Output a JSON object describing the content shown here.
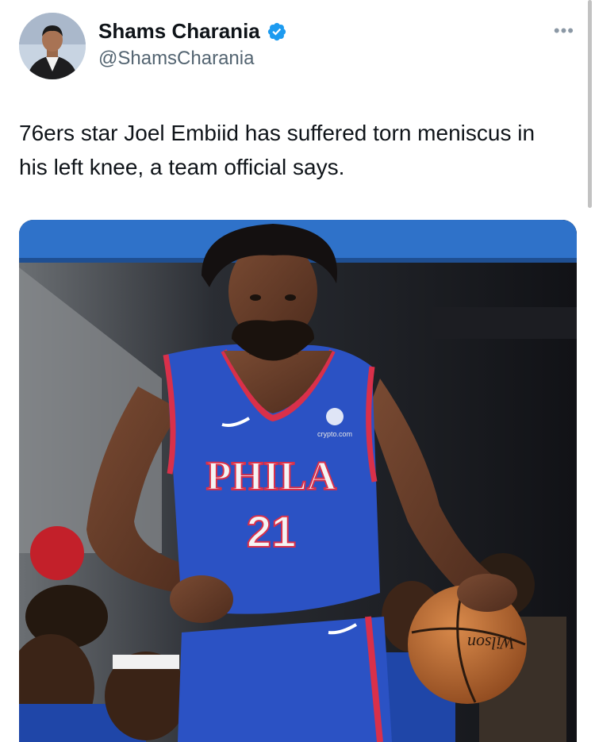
{
  "author": {
    "display_name": "Shams Charania",
    "handle": "@ShamsCharania",
    "verified": true,
    "verified_icon": "verified-badge-icon",
    "avatar_icon": "avatar"
  },
  "more_menu": {
    "label": "•••"
  },
  "tweet": {
    "text": "76ers star Joel Embiid has suffered torn meniscus in his left knee, a team official says."
  },
  "media": {
    "jersey_team": "PHILA",
    "jersey_number": "21",
    "jersey_sponsor": "crypto.com",
    "ball_brand": "Wilson"
  },
  "colors": {
    "text": "#0f1419",
    "secondary": "#536471",
    "verified": "#1d9bf0",
    "jersey": "#2b52c4",
    "jersey_trim": "#d9304a"
  }
}
